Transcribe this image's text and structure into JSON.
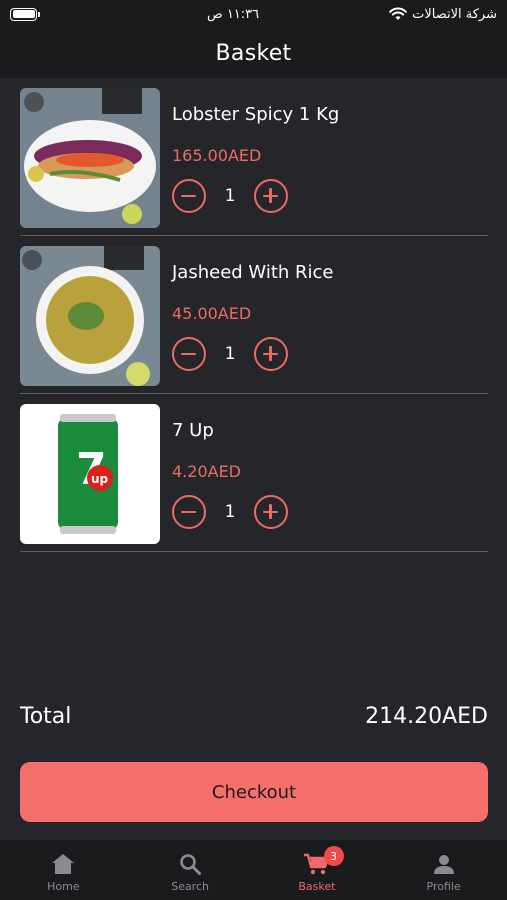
{
  "status_bar": {
    "time": "١١:٣٦ ص",
    "carrier": "شركة الاتصالات"
  },
  "header": {
    "title": "Basket"
  },
  "items": [
    {
      "name": "Lobster Spicy 1 Kg",
      "price": "165.00AED",
      "quantity": "1",
      "image": "lobster-dish"
    },
    {
      "name": "Jasheed With Rice",
      "price": "45.00AED",
      "quantity": "1",
      "image": "rice-dish"
    },
    {
      "name": "7 Up",
      "price": "4.20AED",
      "quantity": "1",
      "image": "7up-can"
    }
  ],
  "total": {
    "label": "Total",
    "value": "214.20AED"
  },
  "checkout": {
    "label": "Checkout"
  },
  "tabbar": {
    "tabs": [
      {
        "label": "Home",
        "icon": "home-icon"
      },
      {
        "label": "Search",
        "icon": "search-icon"
      },
      {
        "label": "Basket",
        "icon": "cart-icon",
        "badge": "3"
      },
      {
        "label": "Profile",
        "icon": "profile-icon"
      }
    ]
  },
  "colors": {
    "accent": "#ee6a6a",
    "background": "#252629",
    "checkout_button": "#f56f6c"
  }
}
